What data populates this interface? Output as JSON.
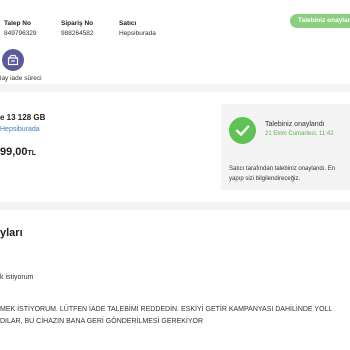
{
  "header": {
    "talep_label": "Talep No",
    "talep_value": "849796329",
    "siparis_label": "Sipariş No",
    "siparis_value": "988264582",
    "satici_label": "Satıcı",
    "satici_value": "Hepsiburada",
    "status_badge": "Talebiniz onaylan"
  },
  "timeline": {
    "label": "lay iade süreci",
    "icon": "return-box-icon"
  },
  "product": {
    "name": "e 13 128 GB",
    "seller": "Hepsiburada",
    "price": "99,00",
    "currency": "TL"
  },
  "status_card": {
    "title": "Talebiniz onaylandı",
    "date": "21 Ekim Cumartesi, 11:42",
    "message_line1": "Satıcı tarafından talebiniz onaylandı. En",
    "message_line2": "yapıp sizi bilgilendireceğiz."
  },
  "details": {
    "title": "yları",
    "reason": "k istiyorum",
    "note_line1": "MEK İSTİYORUM. LÜTFEN İADE TALEBİMİ REDDEDİN. ESKİYİ GETİR KAMPANYASI DAHİLİNDE YOLL",
    "note_line2": "DILAR, BU CİHAZIN BANA GERİ GÖNDERİLMESİ GEREKİYOR"
  },
  "colors": {
    "accent_green": "#5fc254",
    "badge_green": "#8ccf7e",
    "timeline_purple": "#5b5a9b",
    "link_blue": "#3f7fc0"
  }
}
